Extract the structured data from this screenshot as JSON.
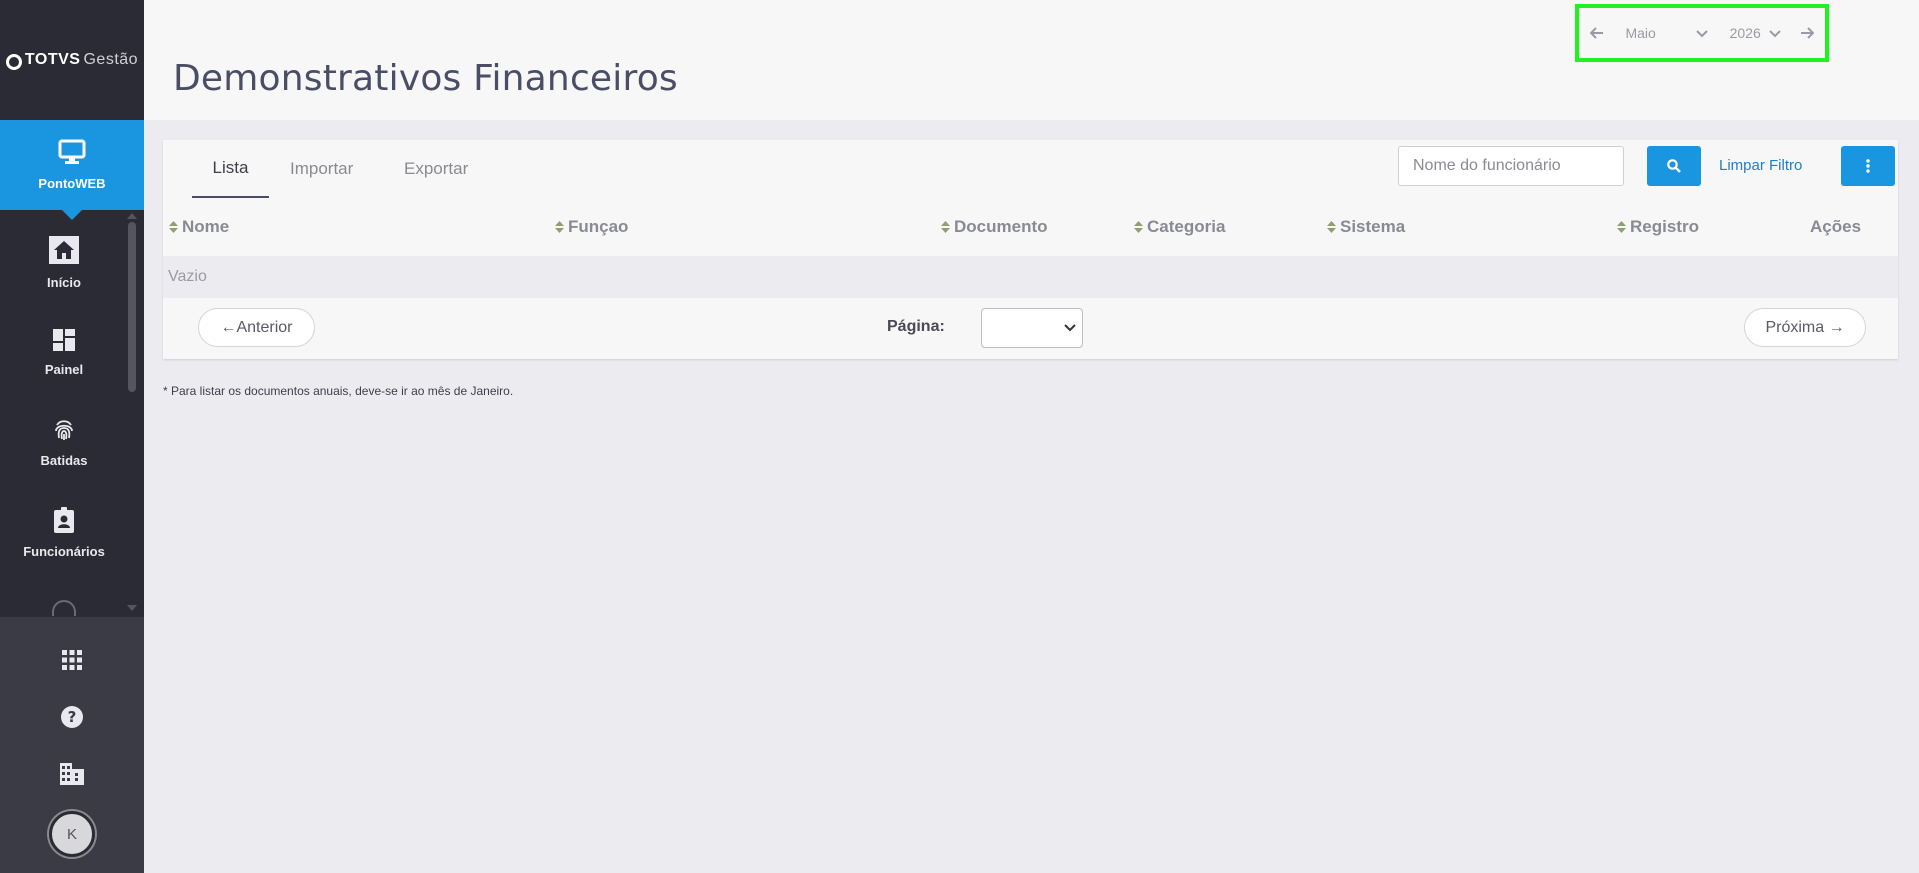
{
  "brand": {
    "logo_bold": "TOTVS",
    "logo_light": "Gestão"
  },
  "sidebar": {
    "active": {
      "label": "PontoWEB",
      "icon": "monitor-icon"
    },
    "items": [
      {
        "label": "Início",
        "icon": "home-icon"
      },
      {
        "label": "Painel",
        "icon": "dashboard-icon"
      },
      {
        "label": "Batidas",
        "icon": "fingerprint-icon"
      },
      {
        "label": "Funcionários",
        "icon": "id-badge-icon"
      }
    ],
    "bottom_icons": [
      "apps-grid-icon",
      "help-icon",
      "company-building-icon"
    ],
    "avatar_initial": "K"
  },
  "header": {
    "title": "Demonstrativos Financeiros",
    "period": {
      "month": "Maio",
      "year": "2026"
    }
  },
  "toolbar": {
    "tabs": [
      "Lista",
      "Importar",
      "Exportar"
    ],
    "active_tab": "Lista",
    "search_placeholder": "Nome do funcionário",
    "clear_filter": "Limpar Filtro"
  },
  "table": {
    "columns": [
      "Nome",
      "Funçao",
      "Documento",
      "Categoria",
      "Sistema",
      "Registro",
      "Ações"
    ],
    "empty_text": "Vazio"
  },
  "pagination": {
    "prev": "←Anterior",
    "next": "Próxima →",
    "page_label": "Página:"
  },
  "footnote": "* Para listar os documentos anuais, deve-se ir ao mês de Janeiro.",
  "colors": {
    "accent": "#1a96e0",
    "sidebar": "#2b2b35",
    "highlight": "#21f021"
  }
}
